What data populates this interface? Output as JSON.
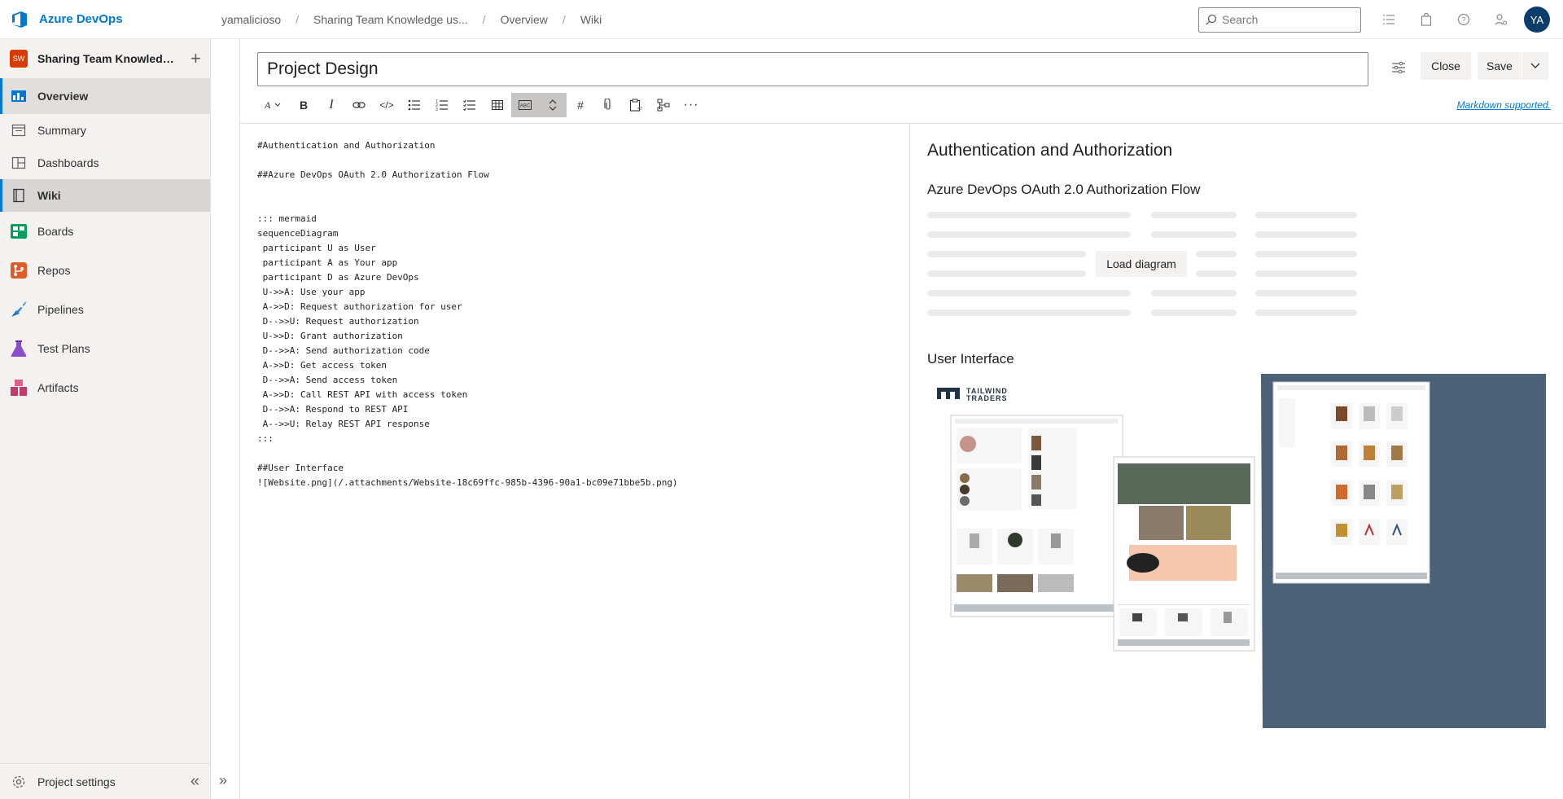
{
  "topbar": {
    "brand": "Azure DevOps",
    "breadcrumbs": [
      "yamalicioso",
      "Sharing Team Knowledge us...",
      "Overview",
      "Wiki"
    ],
    "search_placeholder": "Search",
    "avatar_initials": "YA"
  },
  "sidebar": {
    "project_badge": "SW",
    "project_name": "Sharing Team Knowledge using Wiki",
    "items": [
      {
        "label": "Overview"
      },
      {
        "label": "Summary"
      },
      {
        "label": "Dashboards"
      },
      {
        "label": "Wiki"
      },
      {
        "label": "Boards"
      },
      {
        "label": "Repos"
      },
      {
        "label": "Pipelines"
      },
      {
        "label": "Test Plans"
      },
      {
        "label": "Artifacts"
      }
    ],
    "footer_label": "Project settings"
  },
  "editor": {
    "title_value": "Project Design",
    "close_label": "Close",
    "save_label": "Save",
    "markdown_link": "Markdown supported.",
    "lines": [
      "#Authentication and Authorization",
      "",
      "##Azure DevOps OAuth 2.0 Authorization Flow",
      "",
      "",
      "::: mermaid",
      "sequenceDiagram",
      " participant U as User",
      " participant A as Your app",
      " participant D as Azure DevOps",
      " U->>A: Use your app",
      " A->>D: Request authorization for user",
      " D-->>U: Request authorization",
      " U->>D: Grant authorization",
      " D-->>A: Send authorization code",
      " A->>D: Get access token",
      " D-->>A: Send access token",
      " A->>D: Call REST API with access token",
      " D-->>A: Respond to REST API",
      " A-->>U: Relay REST API response",
      ":::",
      "",
      "##User Interface",
      "![Website.png](/.attachments/Website-18c69ffc-985b-4396-90a1-bc09e71bbe5b.png)"
    ]
  },
  "preview": {
    "h1": "Authentication and Authorization",
    "h2": "Azure DevOps OAuth 2.0 Authorization Flow",
    "load_diagram": "Load diagram",
    "h3": "User Interface",
    "image_logo_line1": "TAILWIND",
    "image_logo_line2": "TRADERS"
  },
  "colors": {
    "accent": "#0078d4",
    "project_badge": "#d83b01",
    "avatar": "#0b3d6b",
    "image_backdrop": "#4b6178"
  }
}
